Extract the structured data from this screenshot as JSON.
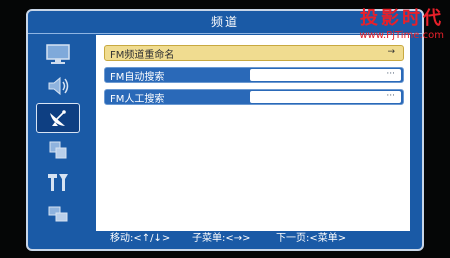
{
  "header": {
    "title": "频道"
  },
  "sidebar": {
    "items": [
      {
        "icon": "monitor-icon"
      },
      {
        "icon": "speaker-icon"
      },
      {
        "icon": "satellite-icon",
        "active": true
      },
      {
        "icon": "squares-icon"
      },
      {
        "icon": "tools-icon"
      },
      {
        "icon": "overlap-icon"
      }
    ]
  },
  "menu": {
    "rows": [
      {
        "label": "FM频道重命名",
        "value": "→"
      },
      {
        "label": "FM自动搜索",
        "value": "···"
      },
      {
        "label": "FM人工搜索",
        "value": "···"
      }
    ]
  },
  "footer": {
    "move": "移动:<↑/↓>",
    "submenu": "子菜单:<→>",
    "next": "下一页:<菜单>"
  },
  "watermark": {
    "title": "投影时代",
    "url": "www.PjTime.com"
  },
  "colors": {
    "panel": "#1a5aa6",
    "selected_row": "#f0dc90",
    "watermark": "#e8202a"
  }
}
